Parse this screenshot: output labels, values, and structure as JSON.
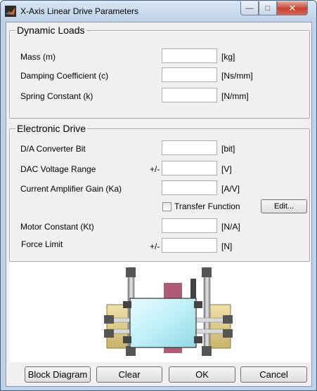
{
  "window": {
    "title": "X-Axis Linear Drive Parameters",
    "app_icon": "matlab-logo-icon",
    "controls": {
      "minimize": "—",
      "maximize": "□",
      "close": "✕"
    }
  },
  "dynamic_loads": {
    "legend": "Dynamic Loads",
    "mass": {
      "label": "Mass (m)",
      "value": "",
      "unit": "[kg]"
    },
    "damping": {
      "label": "Damping Coefficient (c)",
      "value": "",
      "unit": "[Ns/mm]"
    },
    "spring": {
      "label": "Spring Constant (k)",
      "value": "",
      "unit": "[N/mm]"
    }
  },
  "electronic_drive": {
    "legend": "Electronic Drive",
    "da_bit": {
      "label": "D/A Converter Bit",
      "value": "",
      "unit": "[bit]"
    },
    "dac_range": {
      "label": "DAC Voltage Range",
      "prefix": "+/-",
      "value": "",
      "unit": "[V]"
    },
    "amp_gain": {
      "label": "Current Amplifier Gain (Ka)",
      "value": "",
      "unit": "[A/V]"
    },
    "transfer_function": {
      "label": "Transfer Function",
      "checked": false
    },
    "edit_button": "Edit...",
    "motor_constant": {
      "label": "Motor Constant (Kt)",
      "value": "",
      "unit": "[N/A]"
    },
    "force_limit": {
      "label": "Force Limit",
      "prefix": "+/-",
      "value": "",
      "unit": "[N]"
    }
  },
  "picture": {
    "icon": "linear-drive-diagram"
  },
  "buttons": {
    "block_diagram": "Block Diagram",
    "clear": "Clear",
    "ok": "OK",
    "cancel": "Cancel"
  }
}
